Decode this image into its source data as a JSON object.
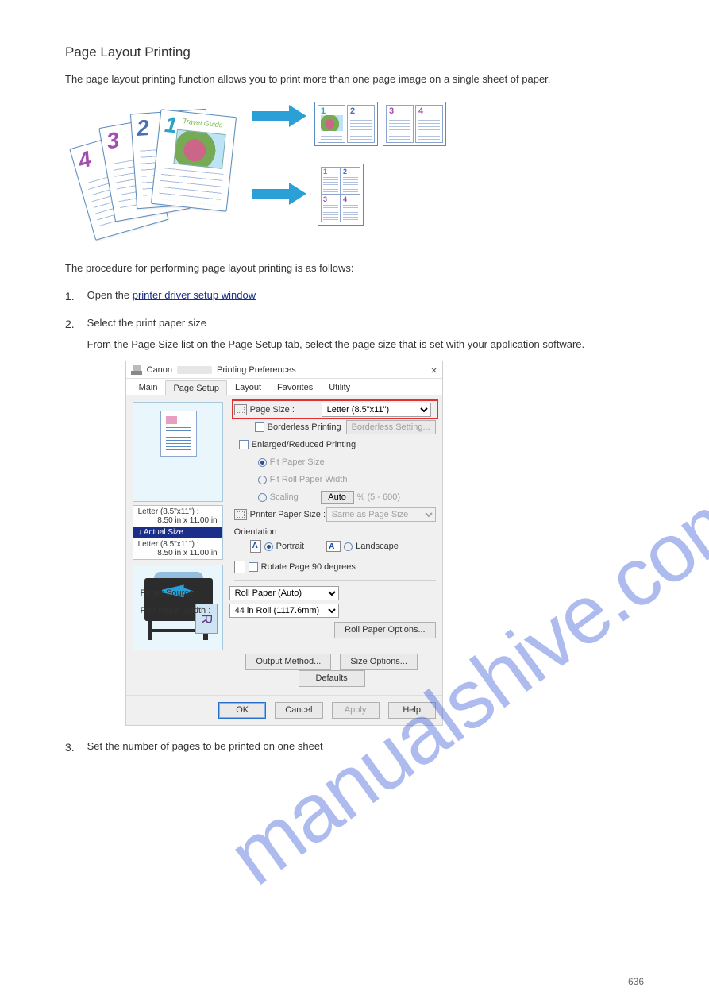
{
  "section_title": "Page Layout Printing",
  "intro_paragraph": "The page layout printing function allows you to print more than one page image on a single sheet of paper.",
  "steps_intro": "The procedure for performing page layout printing is as follows:",
  "steps": [
    {
      "num": "1.",
      "heading_prefix": "Open the ",
      "heading_link": "printer driver setup window"
    },
    {
      "num": "2.",
      "heading": "Select the print paper size",
      "detail": "From the Page Size list on the Page Setup tab, select the page size that is set with your application software."
    },
    {
      "num": "3.",
      "heading": "Set the number of pages to be printed on one sheet"
    }
  ],
  "watermark": "manualshive.com",
  "dialog": {
    "title_prefix": "Canon",
    "title_mid": "",
    "title_suffix": "Printing Preferences",
    "close": "×",
    "tabs": [
      "Main",
      "Page Setup",
      "Layout",
      "Favorites",
      "Utility"
    ],
    "active_tab": 1,
    "preview": {
      "line1_label": "Letter (8.5\"x11\") :",
      "line1_dim": "8.50 in x 11.00 in",
      "actual_size": "Actual Size",
      "line2_label": "Letter (8.5\"x11\") :",
      "line2_dim": "8.50 in x 11.00 in"
    },
    "page_size_label": "Page Size :",
    "page_size_value": "Letter (8.5\"x11\")",
    "borderless_label": "Borderless Printing",
    "borderless_setting": "Borderless Setting...",
    "enlarged_label": "Enlarged/Reduced Printing",
    "fit_paper": "Fit Paper Size",
    "fit_roll": "Fit Roll Paper Width",
    "scaling_label": "Scaling",
    "scaling_value": "Auto",
    "scaling_hint": "%  (5 - 600)",
    "printer_paper_size_label": "Printer Paper Size :",
    "printer_paper_size_value": "Same as Page Size",
    "orientation_label": "Orientation",
    "portrait": "Portrait",
    "landscape": "Landscape",
    "rotate90": "Rotate Page 90 degrees",
    "paper_source_label": "Paper Source :",
    "paper_source_value": "Roll Paper (Auto)",
    "roll_width_label": "Roll Paper Width :",
    "roll_width_value": "44 in Roll (1117.6mm)",
    "roll_options": "Roll Paper Options...",
    "output_method": "Output Method...",
    "size_options": "Size Options...",
    "defaults": "Defaults",
    "ok": "OK",
    "cancel": "Cancel",
    "apply": "Apply",
    "help": "Help"
  },
  "page_number": "636"
}
